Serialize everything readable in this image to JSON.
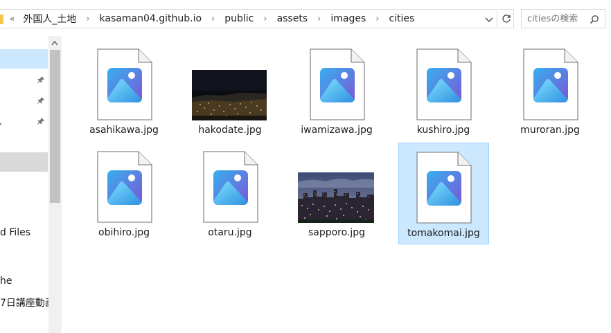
{
  "breadcrumb": {
    "overflow_chevron": "«",
    "items": [
      "外国人_土地",
      "kasaman04.github.io",
      "public",
      "assets",
      "images",
      "cities"
    ]
  },
  "search": {
    "placeholder": "citiesの検索"
  },
  "nav": {
    "items": [
      "d Files",
      "he",
      "7日講座動画"
    ]
  },
  "files": [
    {
      "name": "asahikawa.jpg",
      "kind": "image-icon"
    },
    {
      "name": "hakodate.jpg",
      "kind": "photo-night-harbor"
    },
    {
      "name": "iwamizawa.jpg",
      "kind": "image-icon"
    },
    {
      "name": "kushiro.jpg",
      "kind": "image-icon"
    },
    {
      "name": "muroran.jpg",
      "kind": "image-icon"
    },
    {
      "name": "obihiro.jpg",
      "kind": "image-icon"
    },
    {
      "name": "otaru.jpg",
      "kind": "image-icon"
    },
    {
      "name": "sapporo.jpg",
      "kind": "photo-city-night"
    },
    {
      "name": "tomakomai.jpg",
      "kind": "image-icon",
      "selected": true
    }
  ],
  "colors": {
    "selection": "#cce8ff",
    "selection_border": "#99d1ff",
    "icon_gradient_start": "#3aa0e8",
    "icon_gradient_end": "#7b5bd6"
  }
}
